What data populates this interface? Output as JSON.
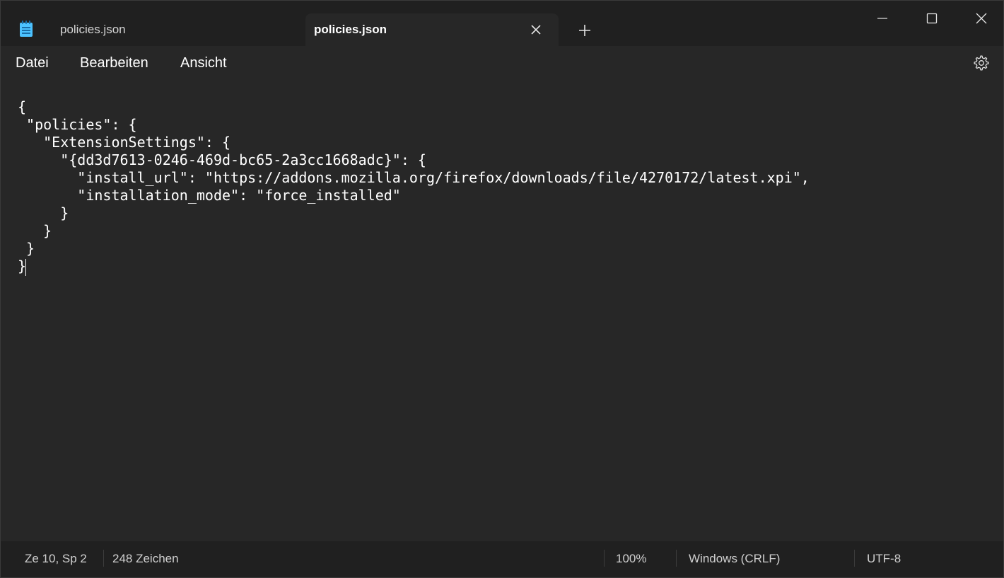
{
  "app": {
    "icon": "notepad-icon"
  },
  "tabs": [
    {
      "label": "policies.json",
      "active": false
    },
    {
      "label": "policies.json",
      "active": true
    }
  ],
  "window_controls": {
    "minimize_icon": "minimize-icon",
    "maximize_icon": "maximize-icon",
    "close_icon": "close-icon",
    "new_tab_icon": "plus-icon",
    "tab_close_icon": "close-icon"
  },
  "menu": {
    "datei": "Datei",
    "bearbeiten": "Bearbeiten",
    "ansicht": "Ansicht",
    "settings_icon": "gear-icon"
  },
  "editor": {
    "content": "{\n \"policies\": {\n   \"ExtensionSettings\": {\n     \"{dd3d7613-0246-469d-bc65-2a3cc1668adc}\": {\n       \"install_url\": \"https://addons.mozilla.org/firefox/downloads/file/4270172/latest.xpi\",\n       \"installation_mode\": \"force_installed\"\n     }\n   }\n }\n}"
  },
  "status": {
    "position": "Ze 10, Sp 2",
    "characters": "248 Zeichen",
    "zoom": "100%",
    "line_endings": "Windows (CRLF)",
    "encoding": "UTF-8"
  },
  "colors": {
    "titlebar_bg": "#202020",
    "editor_bg": "#272727",
    "text": "#ffffff",
    "icon_accent": "#4cc2ff"
  }
}
